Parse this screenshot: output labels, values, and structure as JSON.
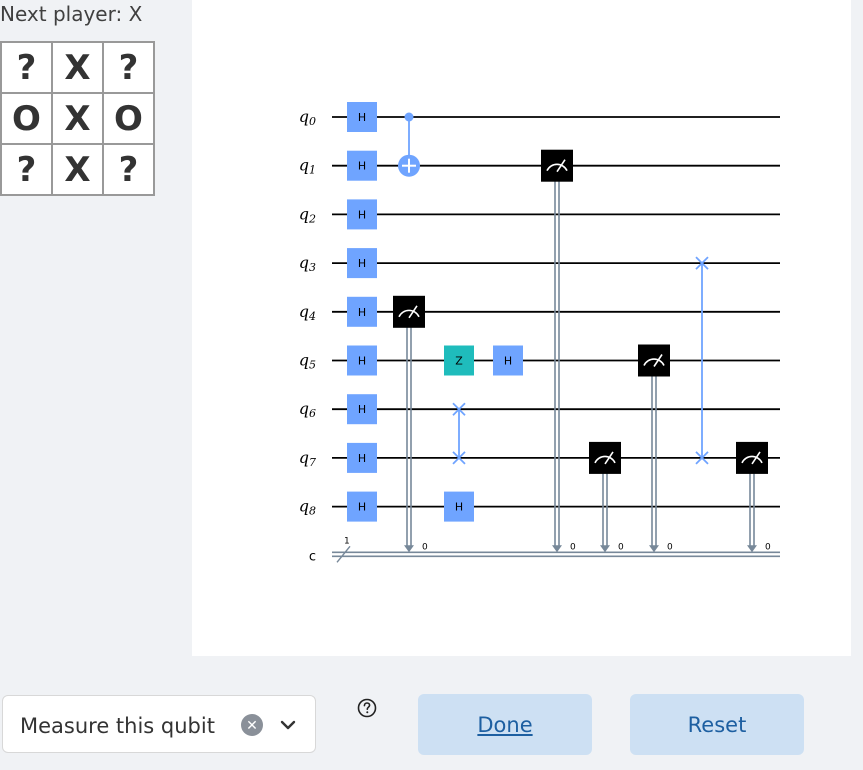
{
  "game": {
    "status": "Next player: X",
    "board": [
      "?",
      "X",
      "?",
      "O",
      "X",
      "O",
      "?",
      "X",
      "?"
    ]
  },
  "circuit": {
    "qubits": [
      "q0",
      "q1",
      "q2",
      "q3",
      "q4",
      "q5",
      "q6",
      "q7",
      "q8"
    ],
    "classical_register": "c",
    "classical_width": "1",
    "gate_colors": {
      "hadamard": "#6fa4ff",
      "z": "#1fbcbc",
      "measure": "#000000",
      "wire": "#000000",
      "classical": "#778899"
    },
    "gates": [
      {
        "type": "H",
        "label": "H",
        "qubit": 0,
        "col": 0
      },
      {
        "type": "H",
        "label": "H",
        "qubit": 1,
        "col": 0
      },
      {
        "type": "H",
        "label": "H",
        "qubit": 2,
        "col": 0
      },
      {
        "type": "H",
        "label": "H",
        "qubit": 3,
        "col": 0
      },
      {
        "type": "H",
        "label": "H",
        "qubit": 4,
        "col": 0
      },
      {
        "type": "H",
        "label": "H",
        "qubit": 5,
        "col": 0
      },
      {
        "type": "H",
        "label": "H",
        "qubit": 6,
        "col": 0
      },
      {
        "type": "H",
        "label": "H",
        "qubit": 7,
        "col": 0
      },
      {
        "type": "H",
        "label": "H",
        "qubit": 8,
        "col": 0
      },
      {
        "type": "CX",
        "control": 0,
        "target": 1,
        "col": 1
      },
      {
        "type": "M",
        "qubit": 4,
        "col": 1,
        "bit_label": "0"
      },
      {
        "type": "Z",
        "label": "Z",
        "qubit": 5,
        "col": 2
      },
      {
        "type": "SWAP",
        "qubits": [
          6,
          7
        ],
        "col": 2
      },
      {
        "type": "H",
        "label": "H",
        "qubit": 8,
        "col": 2
      },
      {
        "type": "H",
        "label": "H",
        "qubit": 5,
        "col": 3
      },
      {
        "type": "M",
        "qubit": 1,
        "col": 4,
        "bit_label": "0"
      },
      {
        "type": "M",
        "qubit": 7,
        "col": 5,
        "bit_label": "0"
      },
      {
        "type": "M",
        "qubit": 5,
        "col": 6,
        "bit_label": "0"
      },
      {
        "type": "SWAP",
        "qubits": [
          3,
          7
        ],
        "col": 7
      },
      {
        "type": "M",
        "qubit": 7,
        "col": 8,
        "bit_label": "0"
      }
    ]
  },
  "controls": {
    "select_value": "Measure this qubit",
    "clear_icon": "close-circle-icon",
    "dropdown_icon": "chevron-down-icon",
    "help_icon": "question-circle-icon",
    "done_label": "Done",
    "reset_label": "Reset"
  }
}
